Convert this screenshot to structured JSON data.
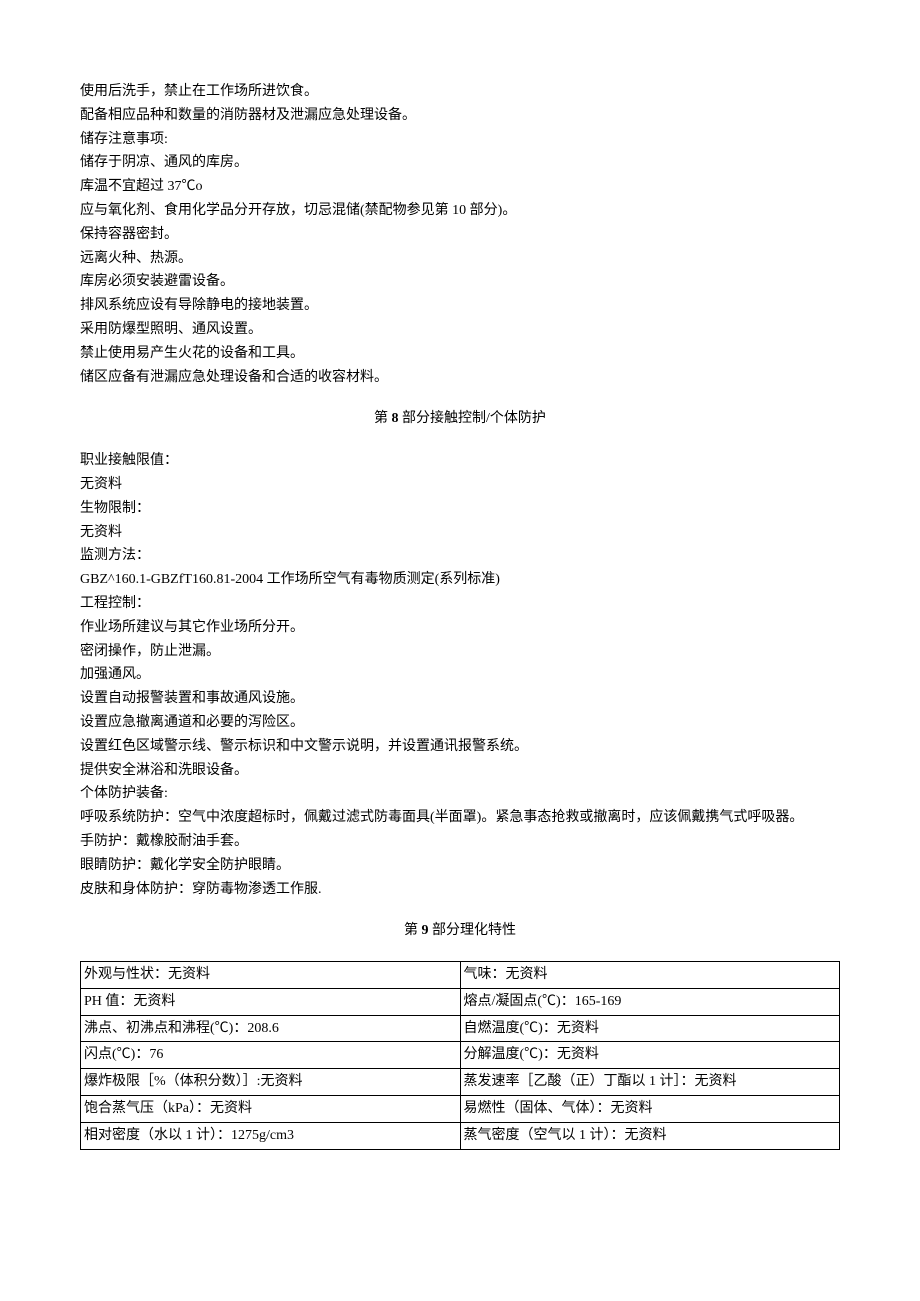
{
  "section7_continued": {
    "lines": [
      "使用后洗手，禁止在工作场所进饮食。",
      "配备相应品种和数量的消防器材及泄漏应急处理设备。",
      "储存注意事项:",
      "储存于阴凉、通风的库房。",
      "库温不宜超过 37℃o",
      "应与氧化剂、食用化学品分开存放，切忌混储(禁配物参见第 10 部分)。",
      "保持容器密封。",
      "远离火种、热源。",
      "库房必须安装避雷设备。",
      "排风系统应设有导除静电的接地装置。",
      "采用防爆型照明、通风设置。",
      "禁止使用易产生火花的设备和工具。",
      "储区应备有泄漏应急处理设备和合适的收容材料。"
    ]
  },
  "section8": {
    "heading_prefix": "第 ",
    "heading_num": "8",
    "heading_suffix": " 部分接触控制/个体防护",
    "lines": [
      "职业接触限值：",
      "无资料",
      "生物限制：",
      "无资料",
      "监测方法：",
      "GBZ^160.1-GBZfT160.81-2004 工作场所空气有毒物质测定(系列标准)",
      "工程控制：",
      "作业场所建议与其它作业场所分开。",
      "密闭操作，防止泄漏。",
      "加强通风。",
      "设置自动报警装置和事故通风设施。",
      "设置应急撤离通道和必要的泻险区。",
      "设置红色区域警示线、警示标识和中文警示说明，并设置通讯报警系统。",
      "提供安全淋浴和洗眼设备。",
      "个体防护装备:",
      "呼吸系统防护：空气中浓度超标时，佩戴过滤式防毒面具(半面罩)。紧急事态抢救或撤离时，应该佩戴携气式呼吸器。",
      "手防护：戴橡胶耐油手套。",
      "眼睛防护：戴化学安全防护眼睛。",
      "皮肤和身体防护：穿防毒物渗透工作服."
    ]
  },
  "section9": {
    "heading_prefix": "第 ",
    "heading_num": "9",
    "heading_suffix": " 部分理化特性",
    "rows": [
      [
        "外观与性状：无资料",
        "气味：无资料"
      ],
      [
        "PH 值：无资料",
        "熔点/凝固点(℃)：165-169"
      ],
      [
        "沸点、初沸点和沸程(℃)：208.6",
        "自燃温度(℃)：无资料"
      ],
      [
        "闪点(℃)：76",
        "分解温度(℃)：无资料"
      ],
      [
        "爆炸极限［%（体积分数）］:无资料",
        "蒸发速率［乙酸（正）丁酯以 1 计］：无资料"
      ],
      [
        "饱合蒸气压（kPa）：无资料",
        "易燃性（固体、气体）：无资料"
      ],
      [
        "相对密度（水以 1 计）：1275g/cm3",
        "蒸气密度（空气以 1 计）：无资料"
      ]
    ]
  }
}
